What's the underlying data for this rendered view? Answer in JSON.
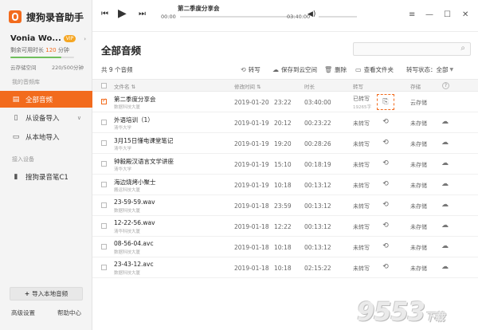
{
  "app": {
    "title": "搜狗录音助手"
  },
  "user": {
    "name": "Vonia Wo...",
    "vip_badge": "VIP",
    "quota_prefix": "剩余可用时长",
    "quota_value": "120",
    "quota_unit": "分钟",
    "quota_fill_fraction": 0.8,
    "cloud_label": "云存储空间",
    "cloud_usage": "220/500分钟"
  },
  "sidebar": {
    "library_label": "我的音频库",
    "items": [
      {
        "label": "全部音频",
        "icon": "doc-icon",
        "active": true
      },
      {
        "label": "从设备导入",
        "icon": "device-icon",
        "active": false
      },
      {
        "label": "从本地导入",
        "icon": "monitor-icon",
        "active": false
      }
    ],
    "device_label": "接入设备",
    "device_name": "搜狗录音笔C1",
    "import_button": "导入本地音频",
    "settings": "高级设置",
    "help": "帮助中心"
  },
  "player": {
    "title": "第二季度分享会",
    "current_time": "00:00",
    "total_time": "03:40:00",
    "progress_fraction": 0.0,
    "volume_fraction": 0.0
  },
  "main": {
    "title": "全部音频",
    "count_text": "共 9 个音频",
    "search_placeholder": ""
  },
  "toolbar": {
    "transcribe": "转写",
    "save_cloud": "保存到云空间",
    "delete": "删除",
    "open_folder": "查看文件夹",
    "status_label": "转写状态：",
    "status_value": "全部"
  },
  "columns": {
    "filename": "文件名 ⇅",
    "modified": "修改时间 ⇅",
    "duration": "时长",
    "transcribe": "转写",
    "storage": "存储",
    "help": "?"
  },
  "rows": [
    {
      "name": "第二季度分享会",
      "sub": "数据科技大厦",
      "date": "2019-01-20",
      "time": "23:22",
      "duration": "03:40:00",
      "status": "已转写",
      "status_sub": "19265字",
      "storage": "云存储",
      "checked": true,
      "cloud_icon": false,
      "highlight": true
    },
    {
      "name": "外语培训（1）",
      "sub": "清华大学",
      "date": "2019-01-19",
      "time": "20:12",
      "duration": "00:23:22",
      "status": "未转写",
      "status_sub": "",
      "storage": "未存储",
      "checked": false,
      "cloud_icon": true,
      "highlight": false
    },
    {
      "name": "3月15日懂电课堂笔记",
      "sub": "清华大学",
      "date": "2019-01-19",
      "time": "19:20",
      "duration": "00:28:26",
      "status": "未转写",
      "status_sub": "",
      "storage": "未存储",
      "checked": false,
      "cloud_icon": true,
      "highlight": false
    },
    {
      "name": "钟毅殿汉语言文学讲座",
      "sub": "清华大学",
      "date": "2019-01-19",
      "time": "15:10",
      "duration": "00:18:19",
      "status": "未转写",
      "status_sub": "",
      "storage": "未存储",
      "checked": false,
      "cloud_icon": true,
      "highlight": false
    },
    {
      "name": "海边烧烤小聚士",
      "sub": "搬运科技大厦",
      "date": "2019-01-19",
      "time": "10:18",
      "duration": "00:13:12",
      "status": "未转写",
      "status_sub": "",
      "storage": "未存储",
      "checked": false,
      "cloud_icon": true,
      "highlight": false
    },
    {
      "name": "23-59-59.wav",
      "sub": "数据科技大厦",
      "date": "2019-01-18",
      "time": "23:59",
      "duration": "00:13:12",
      "status": "未转写",
      "status_sub": "",
      "storage": "未存储",
      "checked": false,
      "cloud_icon": true,
      "highlight": false
    },
    {
      "name": "12-22-56.wav",
      "sub": "清华科技大厦",
      "date": "2019-01-18",
      "time": "12:22",
      "duration": "00:13:12",
      "status": "未转写",
      "status_sub": "",
      "storage": "未存储",
      "checked": false,
      "cloud_icon": true,
      "highlight": false
    },
    {
      "name": "08-56-04.avc",
      "sub": "数据科技大厦",
      "date": "2019-01-18",
      "time": "10:18",
      "duration": "00:13:12",
      "status": "未转写",
      "status_sub": "",
      "storage": "未存储",
      "checked": false,
      "cloud_icon": true,
      "highlight": false
    },
    {
      "name": "23-43-12.avc",
      "sub": "数据科技大厦",
      "date": "2019-01-18",
      "time": "10:18",
      "duration": "02:15:22",
      "status": "未转写",
      "status_sub": "",
      "storage": "未存储",
      "checked": false,
      "cloud_icon": true,
      "highlight": false
    }
  ],
  "watermark": {
    "main": "9553",
    "suffix": "下载"
  }
}
